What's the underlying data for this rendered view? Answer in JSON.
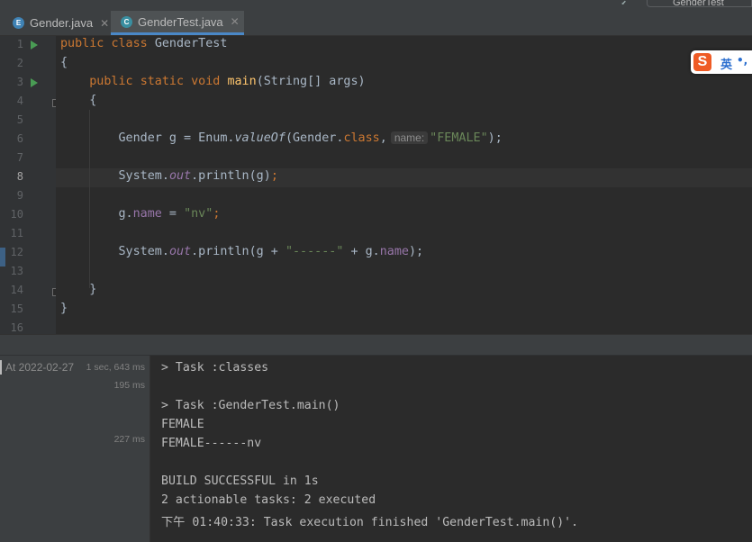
{
  "toolbar": {
    "run_config": "GenderTest"
  },
  "tabs": [
    {
      "label": "Gender.java",
      "icon": "enum-icon",
      "close": "✕"
    },
    {
      "label": "GenderTest.java",
      "icon": "class-icon",
      "close": "✕"
    }
  ],
  "editor": {
    "line_numbers": [
      "1",
      "2",
      "3",
      "4",
      "5",
      "6",
      "7",
      "8",
      "9",
      "10",
      "11",
      "12",
      "13",
      "14",
      "15",
      "16"
    ],
    "current_line": "8",
    "hint_label": "name:",
    "code": {
      "l1_kw1": "public",
      "l1_kw2": "class",
      "l1_name": "GenderTest",
      "l2": "{",
      "l3_kw1": "public",
      "l3_kw2": "static",
      "l3_kw3": "void",
      "l3_fn": "main",
      "l3_rest": "(String[] args)",
      "l4": "{",
      "l6_a": "Gender g = Enum.",
      "l6_fn": "valueOf",
      "l6_b": "(Gender.",
      "l6_kw": "class",
      "l6_c": ",",
      "l6_str": "\"FEMALE\"",
      "l6_d": ");",
      "l8_a": "System.",
      "l8_out": "out",
      "l8_b": ".println(g)",
      "l8_semi": ";",
      "l10_a": "g.",
      "l10_fd": "name",
      "l10_b": " = ",
      "l10_str": "\"nv\"",
      "l10_semi": ";",
      "l12_a": "System.",
      "l12_out": "out",
      "l12_b": ".println(g + ",
      "l12_str": "\"------\"",
      "l12_c": " + g.",
      "l12_fd": "name",
      "l12_d": ");",
      "l14": "}",
      "l15": "}"
    }
  },
  "ime": {
    "logo": "S",
    "lang": "英",
    "punct": "•,"
  },
  "run_tree": {
    "date": "At 2022-02-27",
    "total": "1 sec, 643 ms",
    "t1": "195 ms",
    "t2": "227 ms"
  },
  "console": {
    "lines": [
      "> Task :classes",
      "",
      "> Task :GenderTest.main()",
      "FEMALE",
      "FEMALE------nv",
      "",
      "BUILD SUCCESSFUL in 1s",
      "2 actionable tasks: 2 executed",
      "下午 01:40:33: Task execution finished 'GenderTest.main()'."
    ]
  },
  "colors": {
    "background": "#2b2b2b",
    "keyword": "#cc7832",
    "method": "#ffc66d",
    "string": "#6a8759",
    "field": "#9876aa",
    "run_arrow": "#499c54"
  }
}
